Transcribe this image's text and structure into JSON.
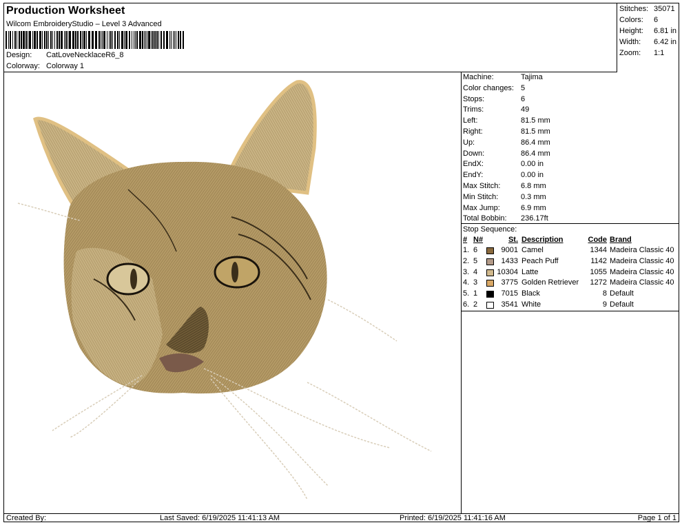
{
  "header": {
    "title": "Production Worksheet",
    "subtitle": "Wilcom EmbroideryStudio – Level 3 Advanced",
    "design_label": "Design:",
    "design_value": "CatLoveNecklaceR6_8",
    "colorway_label": "Colorway:",
    "colorway_value": "Colorway 1"
  },
  "summary": [
    {
      "label": "Stitches:",
      "value": "35071"
    },
    {
      "label": "Colors:",
      "value": "6"
    },
    {
      "label": "Height:",
      "value": "6.81 in"
    },
    {
      "label": "Width:",
      "value": "6.42 in"
    },
    {
      "label": "Zoom:",
      "value": "1:1"
    }
  ],
  "machine_info": [
    {
      "label": "Machine:",
      "value": "Tajima"
    },
    {
      "label": "Color changes:",
      "value": "5"
    },
    {
      "label": "Stops:",
      "value": "6"
    },
    {
      "label": "Trims:",
      "value": "49"
    },
    {
      "label": "Left:",
      "value": "81.5 mm"
    },
    {
      "label": "Right:",
      "value": "81.5 mm"
    },
    {
      "label": "Up:",
      "value": "86.4 mm"
    },
    {
      "label": "Down:",
      "value": "86.4 mm"
    },
    {
      "label": "EndX:",
      "value": "0.00 in"
    },
    {
      "label": "EndY:",
      "value": "0.00 in"
    },
    {
      "label": "Max Stitch:",
      "value": "6.8 mm"
    },
    {
      "label": "Min Stitch:",
      "value": "0.3 mm"
    },
    {
      "label": "Max Jump:",
      "value": "6.9 mm"
    },
    {
      "label": "Total Bobbin:",
      "value": "236.17ft"
    }
  ],
  "stop_sequence": {
    "title": "Stop Sequence:",
    "columns": {
      "hash": "#",
      "n": "N#",
      "st": "St.",
      "description": "Description",
      "code": "Code",
      "brand": "Brand"
    },
    "rows": [
      {
        "idx": "1.",
        "n": "6",
        "color": "#8a6a3e",
        "st": "9001",
        "description": "Camel",
        "code": "1344",
        "brand": "Madeira Classic 40"
      },
      {
        "idx": "2.",
        "n": "5",
        "color": "#b39a88",
        "st": "1433",
        "description": "Peach Puff",
        "code": "1142",
        "brand": "Madeira Classic 40"
      },
      {
        "idx": "3.",
        "n": "4",
        "color": "#d1b98d",
        "st": "10304",
        "description": "Latte",
        "code": "1055",
        "brand": "Madeira Classic 40"
      },
      {
        "idx": "4.",
        "n": "3",
        "color": "#d9a866",
        "st": "3775",
        "description": "Golden Retriever",
        "code": "1272",
        "brand": "Madeira Classic 40"
      },
      {
        "idx": "5.",
        "n": "1",
        "color": "#000000",
        "st": "7015",
        "description": "Black",
        "code": "8",
        "brand": "Default"
      },
      {
        "idx": "6.",
        "n": "2",
        "color": "#ffffff",
        "st": "3541",
        "description": "White",
        "code": "9",
        "brand": "Default"
      }
    ]
  },
  "footer": {
    "created_by": "Created By:",
    "last_saved": "Last Saved: 6/19/2025 11:41:13 AM",
    "printed": "Printed: 6/19/2025 11:41:16 AM",
    "page": "Page 1 of 1"
  },
  "colors": {
    "fur_light": "#c9b07a",
    "fur_mid": "#a08555",
    "fur_dark": "#5c4a2c",
    "ear_rim": "#e0c083",
    "whisker": "#d8cdb8"
  }
}
